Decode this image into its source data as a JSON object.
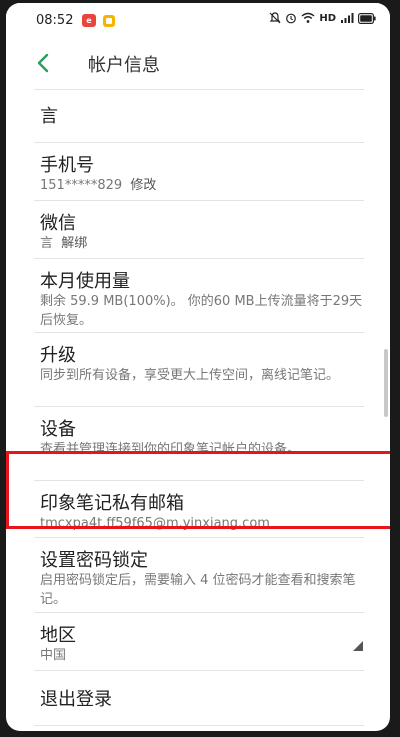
{
  "status_bar": {
    "time": "08:52",
    "badge_text": "e",
    "network_label": "HD"
  },
  "header": {
    "title": "帐户信息"
  },
  "rows": {
    "username": {
      "title": "言"
    },
    "phone": {
      "title": "手机号",
      "value": "151*****829",
      "action": "修改"
    },
    "wechat": {
      "title": "微信",
      "value": "言",
      "action": "解绑"
    },
    "usage": {
      "title": "本月使用量",
      "desc": "剩余 59.9 MB(100%)。 你的60 MB上传流量将于29天后恢复。"
    },
    "upgrade": {
      "title": "升级",
      "desc": "同步到所有设备，享受更大上传空间，离线记笔记。"
    },
    "devices": {
      "title": "设备",
      "desc": "查看并管理连接到你的印象笔记帐户的设备。"
    },
    "email": {
      "title": "印象笔记私有邮箱",
      "value": "tmcxpa4t.ff59f65@m.yinxiang.com"
    },
    "passcode": {
      "title": "设置密码锁定",
      "desc": "启用密码锁定后，需要输入 4 位密码才能查看和搜索笔记。"
    },
    "region": {
      "title": "地区",
      "value": "中国"
    },
    "logout": {
      "title": "退出登录"
    }
  },
  "colors": {
    "accent_green": "#2a9d5c",
    "highlight_red": "#e8131b"
  }
}
